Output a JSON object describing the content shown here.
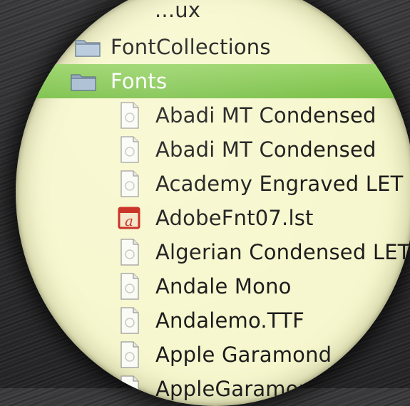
{
  "file_list": {
    "top_partial": "...ux",
    "parent_folder": "FontCollections",
    "selected_folder": "Fonts",
    "items": [
      {
        "label": "Abadi MT Condensed",
        "icon": "generic-document-icon"
      },
      {
        "label": "Abadi MT Condensed",
        "icon": "generic-document-icon"
      },
      {
        "label": "Academy Engraved LET",
        "icon": "generic-document-icon"
      },
      {
        "label": "AdobeFnt07.lst",
        "icon": "acrobat-document-icon"
      },
      {
        "label": "Algerian Condensed LET",
        "icon": "generic-document-icon"
      },
      {
        "label": "Andale Mono",
        "icon": "generic-document-icon"
      },
      {
        "label": "Andalemo.TTF",
        "icon": "generic-document-icon"
      },
      {
        "label": "Apple Garamond",
        "icon": "generic-document-icon"
      },
      {
        "label": "AppleGaramond",
        "icon": "generic-document-icon"
      }
    ]
  },
  "colors": {
    "selection": "#86c853",
    "lens_background": "#f7f7cf",
    "acrobat_red": "#c8281c"
  }
}
